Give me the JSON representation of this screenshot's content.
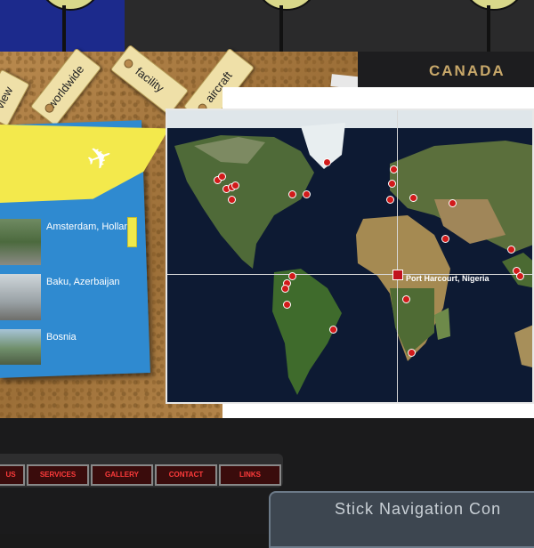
{
  "tags": [
    "view",
    "worldwide",
    "facility",
    "aircraft"
  ],
  "passport": {
    "label": "CANADA"
  },
  "destinations": [
    {
      "name": "Amsterdam, Holland"
    },
    {
      "name": "Baku, Azerbaijan"
    },
    {
      "name": "Bosnia"
    }
  ],
  "map": {
    "selected_location": "Port Harcourt, Nigeria"
  },
  "nav": [
    "US",
    "SERVICES",
    "GALLERY",
    "CONTACT",
    "LINKS"
  ],
  "footer": {
    "title": "Stick Navigation Con"
  },
  "colors": {
    "accent_blue": "#2f8ad0",
    "accent_yellow": "#f3e94c",
    "pin_red": "#d11a1a",
    "nav_red": "#ff3b3b"
  }
}
